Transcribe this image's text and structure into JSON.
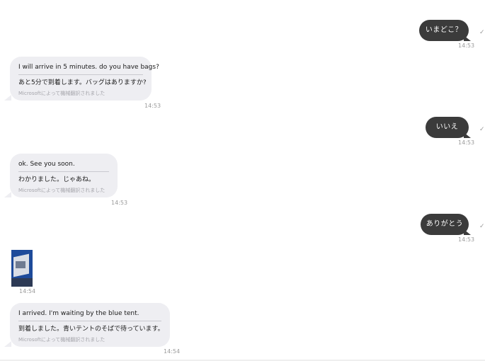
{
  "messages": {
    "out1": {
      "text": "いまどこ？",
      "time": "14:53"
    },
    "in1": {
      "en": "I will arrive in 5 minutes. do you have bags?",
      "jp": "あと5分で到着します。バッグはありますか?",
      "note": "Microsoftによって機械翻訳されました",
      "time": "14:53"
    },
    "out2": {
      "text": "いいえ",
      "time": "14:53"
    },
    "in2": {
      "en": "ok. See you soon.",
      "jp": "わかりました。じゃあね。",
      "note": "Microsoftによって機械翻訳されました",
      "time": "14:53"
    },
    "out3": {
      "text": "ありがとう",
      "time": "14:53"
    },
    "photo": {
      "time": "14:54"
    },
    "in3": {
      "en": "I arrived. I'm waiting by the blue tent.",
      "jp": "到着しました。青いテントのそばで待っています。",
      "note": "Microsoftによって機械翻訳されました",
      "time": "14:54"
    }
  },
  "icons": {
    "sent_check": "check-icon"
  },
  "colors": {
    "outgoing_bubble": "#3b3b3b",
    "incoming_bubble": "#eeeef2",
    "timestamp": "#9a9a9a"
  }
}
